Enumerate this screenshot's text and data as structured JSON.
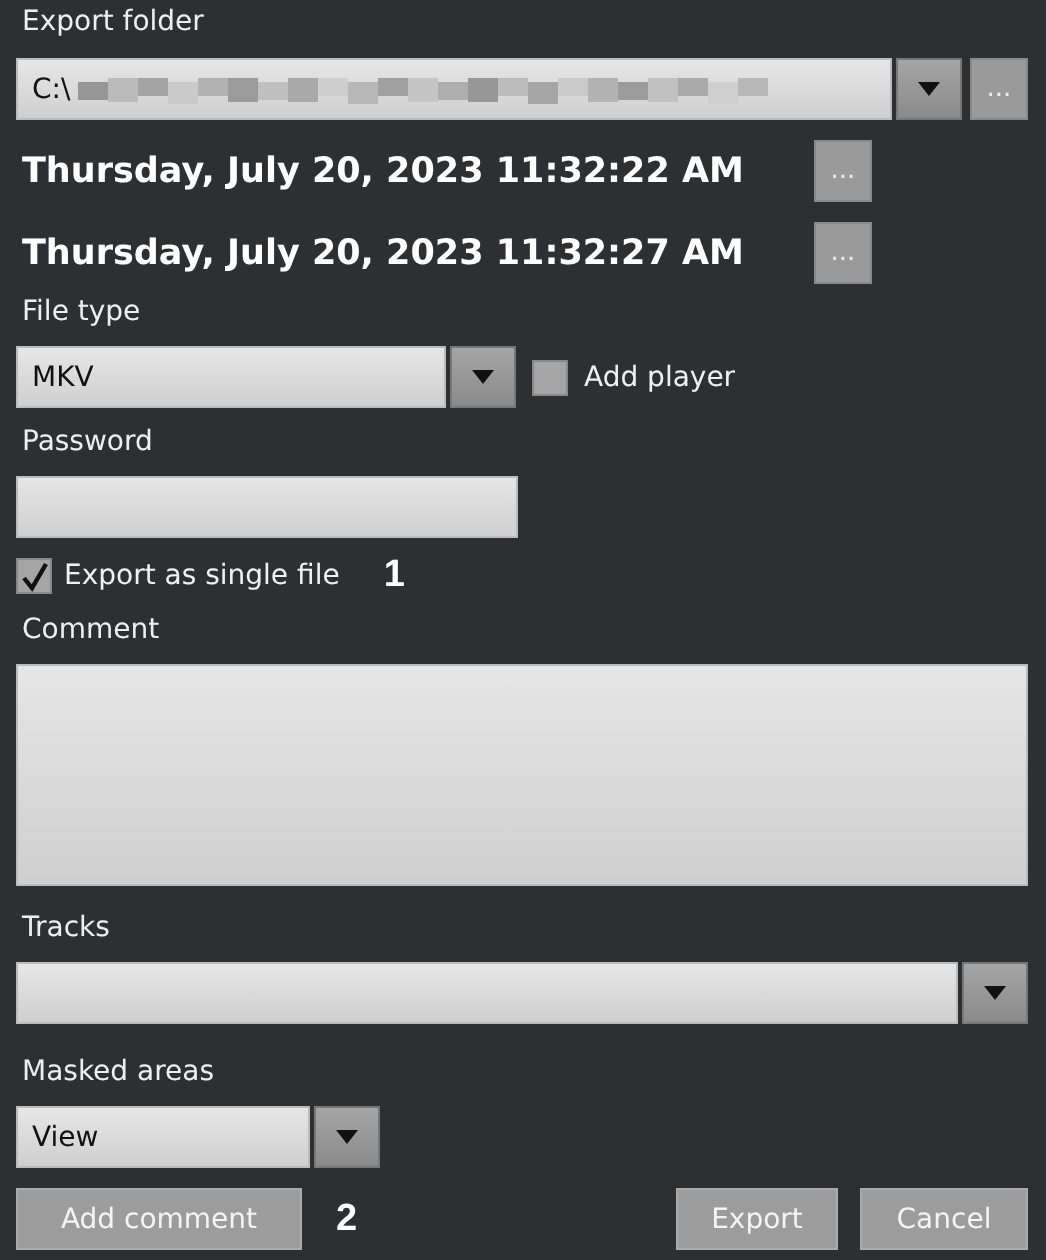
{
  "export_folder": {
    "label": "Export folder",
    "value": "C:\\",
    "redacted": true,
    "browse_button": "..."
  },
  "dates": [
    {
      "value": "Thursday, July 20, 2023 11:32:22 AM",
      "button": "..."
    },
    {
      "value": "Thursday, July 20, 2023 11:32:27 AM",
      "button": "..."
    }
  ],
  "file_type": {
    "label": "File type",
    "value": "MKV"
  },
  "add_player": {
    "label": "Add player",
    "checked": false
  },
  "password": {
    "label": "Password"
  },
  "single_file": {
    "label": "Export as single file",
    "checked": true,
    "callout": "1"
  },
  "comment": {
    "label": "Comment"
  },
  "tracks": {
    "label": "Tracks"
  },
  "masked_areas": {
    "label": "Masked areas",
    "value": "View"
  },
  "buttons": {
    "add_comment": "Add comment",
    "callout": "2",
    "export": "Export",
    "cancel": "Cancel"
  }
}
